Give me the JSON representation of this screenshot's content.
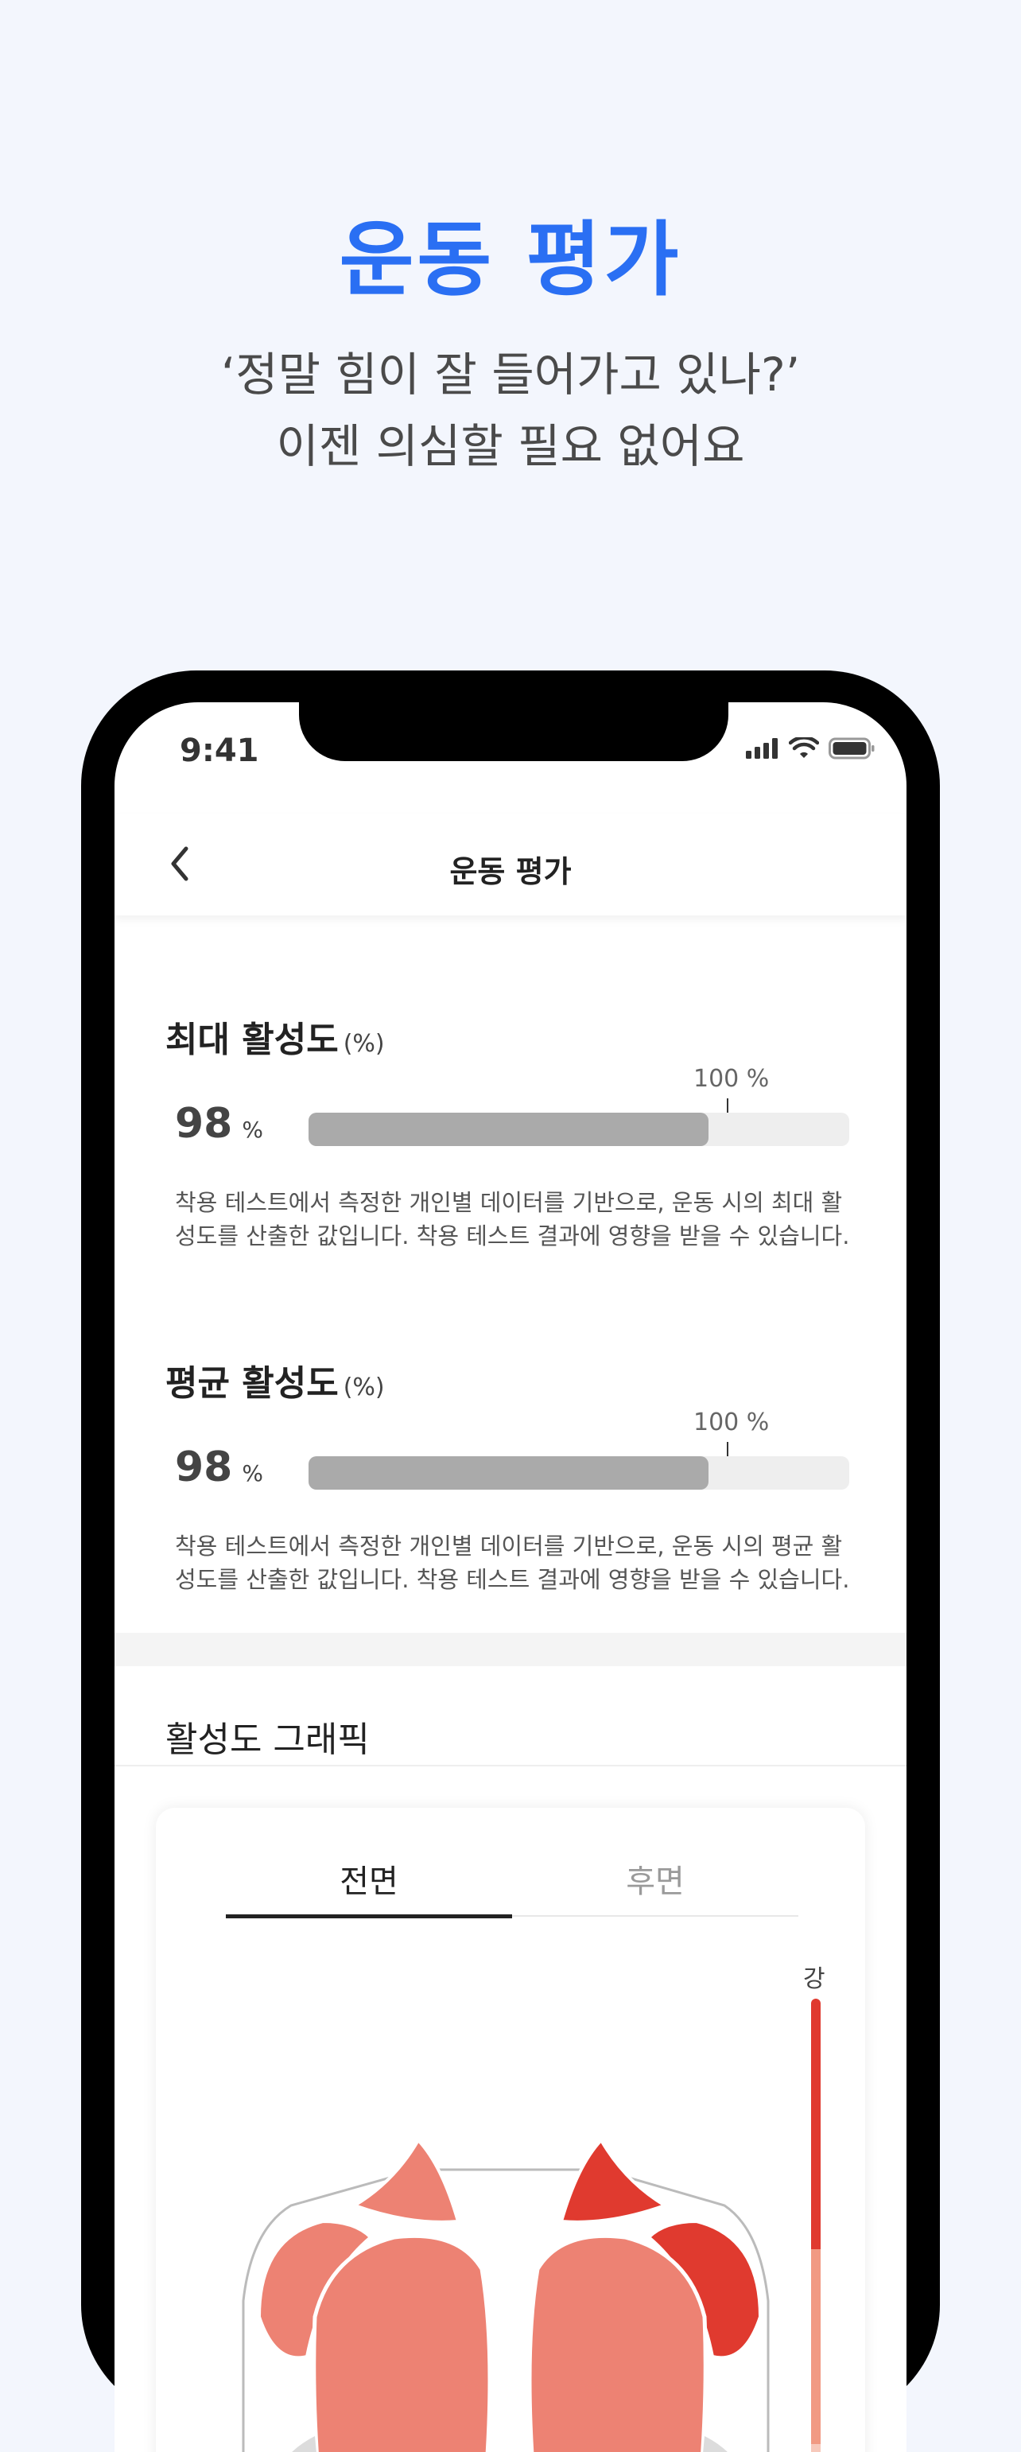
{
  "promo": {
    "title": "운동 평가",
    "subtitle_line1": "‘정말 힘이 잘 들어가고 있나?’",
    "subtitle_line2": "이젠 의심할 필요 없어요"
  },
  "status_bar": {
    "time": "9:41",
    "icons": [
      "signal-icon",
      "wifi-icon",
      "battery-icon"
    ]
  },
  "header": {
    "back_icon": "chevron-left-icon",
    "title": "운동 평가"
  },
  "max_activation": {
    "title": "최대 활성도",
    "unit": "(%)",
    "value": "98",
    "value_unit": "%",
    "bar_level_percent": 74,
    "max_label": "100 %",
    "description": "착용 테스트에서 측정한 개인별 데이터를 기반으로, 운동 시의 최대 활성도를 산출한 값입니다. 착용 테스트 결과에 영향을 받을 수 있습니다."
  },
  "avg_activation": {
    "title": "평균 활성도",
    "unit": "(%)",
    "value": "98",
    "value_unit": "%",
    "bar_level_percent": 74,
    "max_label": "100 %",
    "description": "착용 테스트에서 측정한 개인별 데이터를 기반으로, 운동 시의 평균 활성도를 산출한 값입니다. 착용 테스트 결과에 영향을 받을 수 있습니다."
  },
  "graphic": {
    "title": "활성도 그래픽",
    "tabs": [
      {
        "label": "전면",
        "active": true
      },
      {
        "label": "후면",
        "active": false
      }
    ],
    "legend_top": "강"
  },
  "colors": {
    "brand_blue": "#2a6ff3",
    "bar_fill": "#aaaaaa",
    "muscle_strong": "#e03a2f",
    "muscle_medium": "#ed8273"
  }
}
